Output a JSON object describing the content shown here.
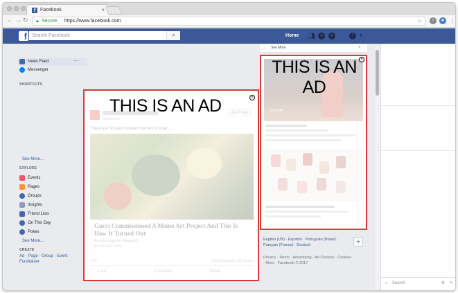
{
  "browser": {
    "tab_title": "Facebook",
    "tab_close": "×",
    "secure_label": "Secure",
    "url": "https://www.facebook.com"
  },
  "fb": {
    "logo": "f",
    "search_placeholder": "Search Facebook",
    "home_label": "Home"
  },
  "sidebar": {
    "items": [
      {
        "label": "News Feed",
        "color": "#4267b2"
      },
      {
        "label": "Messenger",
        "color": "#0084ff"
      }
    ],
    "more_dots": "···",
    "shortcuts_title": "SHORTCUTS",
    "see_more_1": "See More...",
    "explore_title": "EXPLORE",
    "explore_items": [
      {
        "label": "Events",
        "color": "#f35369"
      },
      {
        "label": "Pages",
        "color": "#f7923b"
      },
      {
        "label": "Groups",
        "color": "#4267b2"
      },
      {
        "label": "Insights",
        "color": "#8b9dc3"
      },
      {
        "label": "Friend Lists",
        "color": "#4267b2"
      },
      {
        "label": "On This Day",
        "color": "#4267b2"
      },
      {
        "label": "Pokes",
        "color": "#4267b2"
      }
    ],
    "see_more_2": "See More...",
    "create_title": "CREATE",
    "create_links": "Ad · Page · Group · Event · Fundraiser"
  },
  "feed_ad": {
    "overlay_label": "THIS IS AN AD",
    "close_glyph": "×",
    "page_sub": "Sponsored",
    "like_page": "Like Page",
    "post_text": "There are 56 watch-based memes in total...",
    "headline": "Gucci Commissioned A Meme Art Project And This Is How It Turned Out",
    "description": "Are you ready for #tfwgucci?",
    "domain": "BUZZFEED.COM",
    "reaction_count": "4.2K",
    "comments_shares": "205 Comments  162 Shares",
    "actions": [
      "Like",
      "Comment",
      "Share"
    ]
  },
  "right": {
    "see_more": "See More",
    "help_glyph": "?",
    "side_ad": {
      "overlay_label": "THIS IS AN AD",
      "close_glyph": "×",
      "logo_text": "verizon"
    },
    "languages": "English (US) · Español · Português (Brasil) · Français (France) · Deutsch",
    "add_lang": "+",
    "footer": "Privacy · Terms · Advertising · Ad Choices · Cookies · More · Facebook © 2017"
  },
  "chat": {
    "search_placeholder": "Search"
  }
}
